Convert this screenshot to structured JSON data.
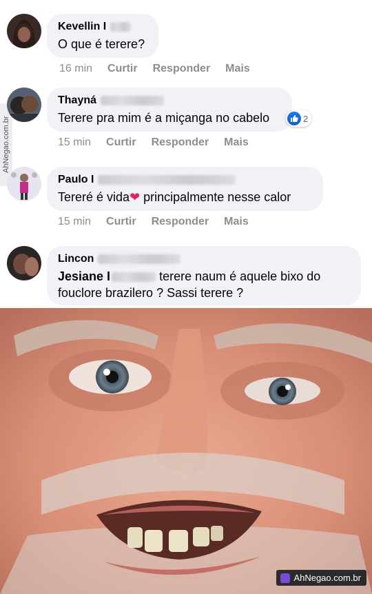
{
  "watermark_side": "AhNegao.com.br",
  "watermark_badge": "AhNegao.com.br",
  "colors": {
    "like_blue": "#1877f2",
    "heart_red": "#e0245e",
    "bubble_bg": "#f0f2f5",
    "meta_grey": "#8a8d91"
  },
  "comments": [
    {
      "name": "Kevellin I",
      "text": "O que é terere?",
      "time": "16 min",
      "like": "Curtir",
      "reply": "Responder",
      "more": "Mais"
    },
    {
      "name": "Thayná",
      "text": "Terere pra mim é a miçanga no cabelo",
      "time": "15 min",
      "like": "Curtir",
      "reply": "Responder",
      "more": "Mais",
      "reaction_count": "2"
    },
    {
      "name": "Paulo I",
      "text_before": "Tereré é vida",
      "text_after": " principalmente nesse calor",
      "time": "15 min",
      "like": "Curtir",
      "reply": "Responder",
      "more": "Mais"
    },
    {
      "name": "Lincon",
      "mention": "Jesiane I",
      "text": " terere naum é aquele bixo do fouclore brazilero ? Sassi terere ?"
    }
  ]
}
